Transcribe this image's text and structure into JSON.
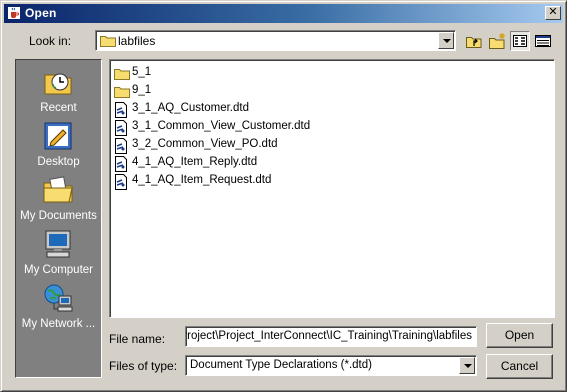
{
  "window": {
    "title": "Open",
    "close_symbol": "✕"
  },
  "lookin": {
    "label": "Look in:",
    "value": "labfiles"
  },
  "toolbar": {
    "buttons": [
      {
        "name": "up-one-level-icon"
      },
      {
        "name": "new-folder-icon"
      },
      {
        "name": "list-view-icon",
        "pressed": true
      },
      {
        "name": "details-view-icon",
        "pressed": false
      }
    ]
  },
  "places": [
    {
      "label": "Recent",
      "icon": "recent-icon"
    },
    {
      "label": "Desktop",
      "icon": "desktop-icon"
    },
    {
      "label": "My Documents",
      "icon": "my-documents-icon"
    },
    {
      "label": "My Computer",
      "icon": "my-computer-icon"
    },
    {
      "label": "My Network ...",
      "icon": "my-network-icon"
    }
  ],
  "files": [
    {
      "name": "5_1",
      "type": "folder"
    },
    {
      "name": "9_1",
      "type": "folder"
    },
    {
      "name": "3_1_AQ_Customer.dtd",
      "type": "dtd"
    },
    {
      "name": "3_1_Common_View_Customer.dtd",
      "type": "dtd"
    },
    {
      "name": "3_2_Common_View_PO.dtd",
      "type": "dtd"
    },
    {
      "name": "4_1_AQ_Item_Reply.dtd",
      "type": "dtd"
    },
    {
      "name": "4_1_AQ_Item_Request.dtd",
      "type": "dtd"
    }
  ],
  "filename": {
    "label": "File name:",
    "value": "ny\\Project\\Project_InterConnect\\IC_Training\\Training\\labfiles"
  },
  "filetype": {
    "label": "Files of type:",
    "value": "Document Type Declarations (*.dtd)"
  },
  "buttons": {
    "open": "Open",
    "cancel": "Cancel"
  },
  "colors": {
    "title_start": "#0a246a",
    "title_end": "#a6caf0",
    "face": "#d4d0c8",
    "places_bg": "#808080"
  }
}
